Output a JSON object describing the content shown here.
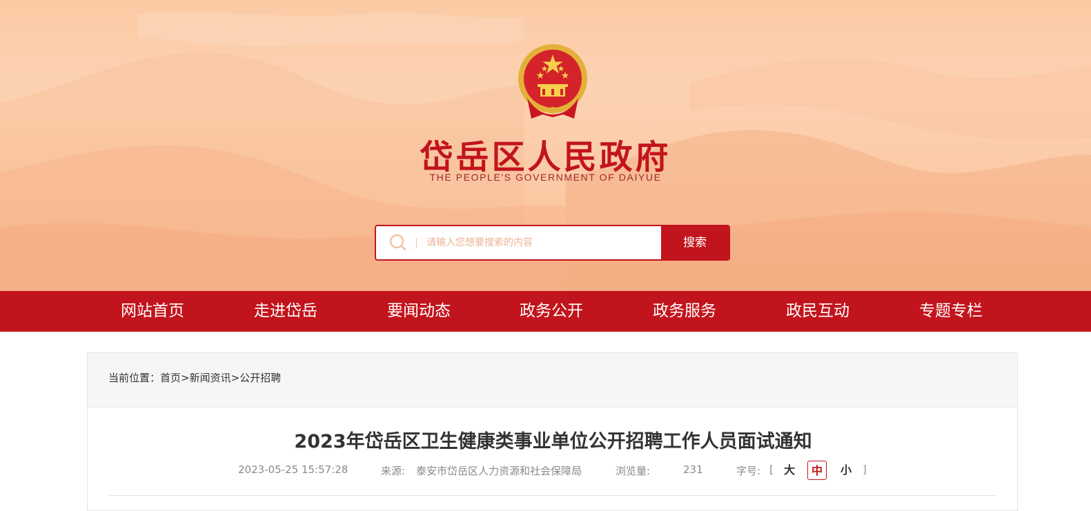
{
  "banner": {
    "site_title": "岱岳区人民政府",
    "site_subtitle": "THE PEOPLE'S GOVERNMENT OF DAIYUE",
    "emblem_icon": "national-emblem-icon"
  },
  "search": {
    "placeholder": "请输入您想要搜索的内容",
    "button_label": "搜索",
    "icon": "search-icon"
  },
  "nav": {
    "items": [
      {
        "label": "网站首页"
      },
      {
        "label": "走进岱岳"
      },
      {
        "label": "要闻动态"
      },
      {
        "label": "政务公开"
      },
      {
        "label": "政务服务"
      },
      {
        "label": "政民互动"
      },
      {
        "label": "专题专栏"
      }
    ]
  },
  "breadcrumb": {
    "prefix": "当前位置：",
    "items": [
      {
        "label": "首页"
      },
      {
        "label": "新闻资讯"
      },
      {
        "label": "公开招聘"
      }
    ],
    "separator": ">"
  },
  "article": {
    "title": "2023年岱岳区卫生健康类事业单位公开招聘工作人员面试通知",
    "date": "2023-05-25 15:57:28",
    "source_label": "来源:",
    "source": "泰安市岱岳区人力资源和社会保障局",
    "views_label": "浏览量:",
    "views": "231",
    "font_size_label": "字号:",
    "bracket_open": "[",
    "bracket_close": "]",
    "font_sizes": {
      "large": "大",
      "medium": "中",
      "small": "小"
    },
    "active_font_size": "medium"
  },
  "colors": {
    "brand_red": "#c2141c",
    "banner_peach": "#fbcaa4",
    "text_dark": "#333333",
    "text_muted": "#8a8a8a"
  }
}
